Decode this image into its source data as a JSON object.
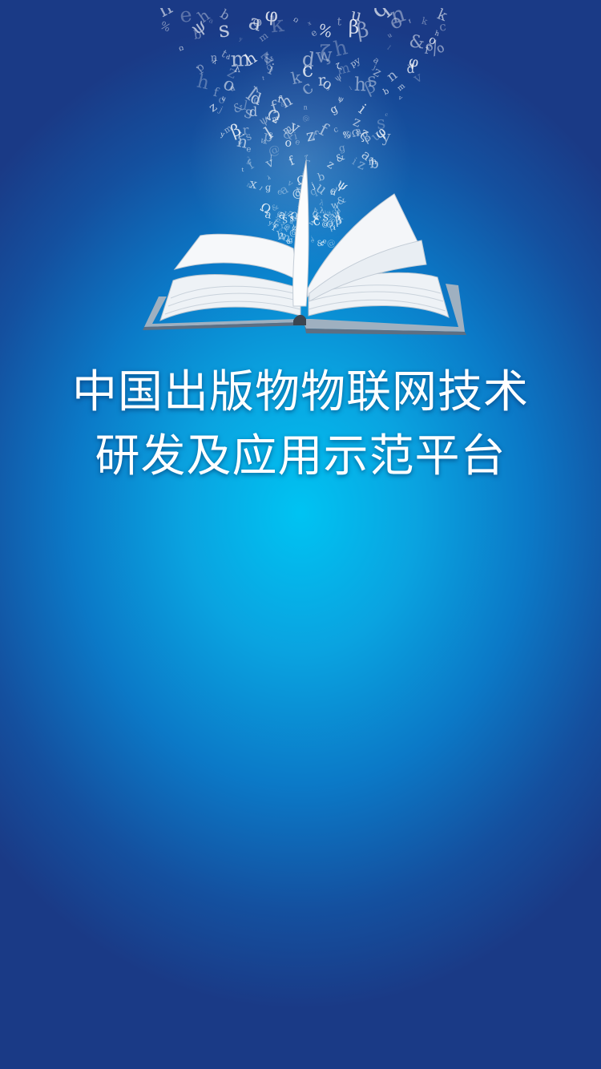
{
  "splash": {
    "title_line_1": "中国出版物物联网技术",
    "title_line_2": "研发及应用示范平台",
    "illustration": "open-book-with-flying-letters",
    "colors": {
      "background_center": "#00c3f2",
      "background_edge": "#1a3a86",
      "title_text": "#ffffff"
    }
  }
}
